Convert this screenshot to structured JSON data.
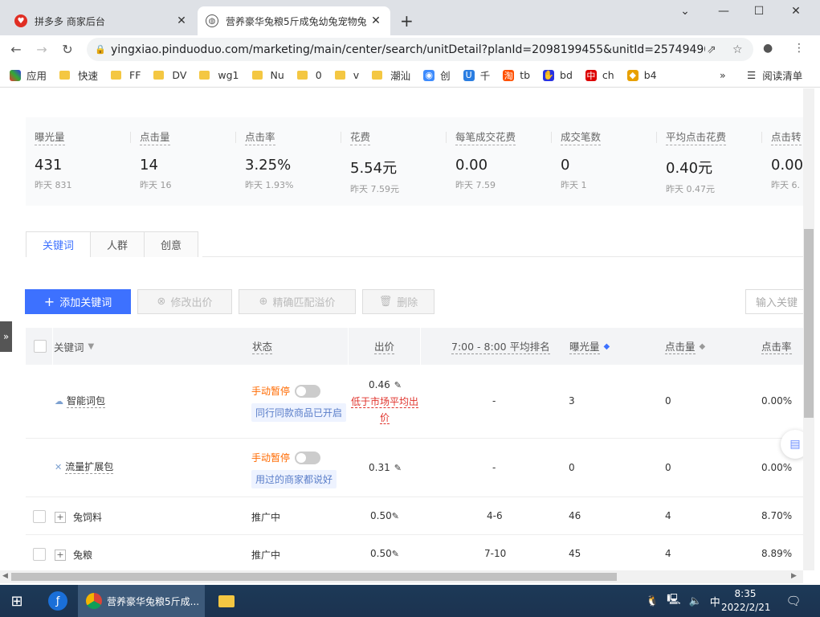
{
  "browser": {
    "tabs": [
      {
        "title": "拼多多 商家后台",
        "close": "✕"
      },
      {
        "title": "营养豪华兔粮5斤成兔幼兔宠物兔",
        "close": "✕"
      }
    ],
    "new_tab": "+",
    "url": "yingxiao.pinduoduo.com/marketing/main/center/search/unitDetail?planId=2098199455&unitId=25749490...",
    "bookmarks": [
      "应用",
      "快速",
      "FF",
      "DV",
      "wg1",
      "Nu",
      "0",
      "v",
      "潮汕",
      "创",
      "千",
      "tb",
      "bd",
      "ch",
      "b4"
    ],
    "bookmarks_more": "»",
    "reading_list": "阅读清单"
  },
  "stats": [
    {
      "label": "曝光量",
      "value": "431",
      "yesterday": "昨天 831"
    },
    {
      "label": "点击量",
      "value": "14",
      "yesterday": "昨天 16"
    },
    {
      "label": "点击率",
      "value": "3.25%",
      "yesterday": "昨天 1.93%"
    },
    {
      "label": "花费",
      "value": "5.54元",
      "yesterday": "昨天 7.59元"
    },
    {
      "label": "每笔成交花费",
      "value": "0.00",
      "yesterday": "昨天 7.59"
    },
    {
      "label": "成交笔数",
      "value": "0",
      "yesterday": "昨天 1"
    },
    {
      "label": "平均点击花费",
      "value": "0.40元",
      "yesterday": "昨天 0.47元"
    },
    {
      "label": "点击转",
      "value": "0.00",
      "yesterday": "昨天 6."
    }
  ],
  "content_tabs": [
    "关键词",
    "人群",
    "创意"
  ],
  "actions": {
    "add": "添加关键词",
    "modify": "修改出价",
    "precise": "精确匹配溢价",
    "delete": "删除",
    "search_placeholder": "输入关键"
  },
  "table": {
    "headers": {
      "keyword": "关键词",
      "status": "状态",
      "bid": "出价",
      "rank": "7:00 - 8:00 平均排名",
      "impressions": "曝光量",
      "clicks": "点击量",
      "ctr": "点击率"
    },
    "rows": [
      {
        "keyword": "智能词包",
        "status": "手动暂停",
        "tag": "同行同款商品已开启",
        "bid": "0.46",
        "warn": "低于市场平均出价",
        "rank": "-",
        "impressions": "3",
        "clicks": "0",
        "ctr": "0.00%"
      },
      {
        "keyword": "流量扩展包",
        "status": "手动暂停",
        "tag": "用过的商家都说好",
        "bid": "0.31",
        "rank": "-",
        "impressions": "0",
        "clicks": "0",
        "ctr": "0.00%"
      },
      {
        "keyword": "兔饲料",
        "status": "推广中",
        "bid": "0.50",
        "rank": "4-6",
        "impressions": "46",
        "clicks": "4",
        "ctr": "8.70%"
      },
      {
        "keyword": "兔粮",
        "status": "推广中",
        "bid": "0.50",
        "rank": "7-10",
        "impressions": "45",
        "clicks": "4",
        "ctr": "8.89%"
      }
    ]
  },
  "taskbar": {
    "app_title": "营养豪华兔粮5斤成...",
    "ime": "中",
    "time": "8:35",
    "date": "2022/2/21"
  },
  "colors": {
    "accent": "#3d71ff",
    "warn": "#e0332c",
    "paused": "#ff6a00"
  }
}
